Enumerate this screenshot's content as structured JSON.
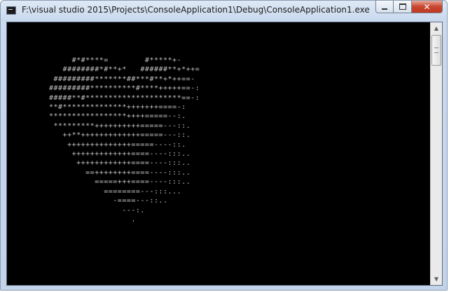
{
  "window": {
    "title": "F:\\visual studio 2015\\Projects\\ConsoleApplication1\\Debug\\ConsoleApplication1.exe",
    "app_icon": "console-app-icon",
    "buttons": {
      "minimize": "minimize-icon",
      "maximize": "maximize-icon",
      "close_label": "✕"
    }
  },
  "console": {
    "output": "     #*#****=        #*****+-\n   ########*#**+*   ######**+*++=\n #########*******##***#**+*++==-\n#########**********#****+++++==-:\n#####**#*********************==-:\n**#**************+++++++====-:\n*****************++++=====--:.\n *********++++++++++=====---::.\n   ++**+++++++++++++=====---::.\n    ++++++++++++++=====----::.\n     +++++++++++++====----:::..\n      ++++++++++++====----:::..\n        ==++++++++====----:::..\n          =====+++====----:::..\n            ========---:::...\n              -====---::..\n                ---:.\n                  ."
  },
  "scrollbar": {
    "up_arrow": "scroll-up-icon",
    "down_arrow": "scroll-down-icon"
  }
}
